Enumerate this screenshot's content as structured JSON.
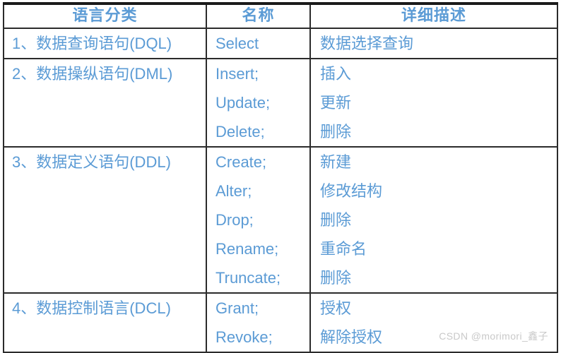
{
  "table": {
    "headers": [
      {
        "label": "语言分类"
      },
      {
        "label": "名称"
      },
      {
        "label": "详细描述"
      }
    ],
    "rows": [
      {
        "category": "1、数据查询语句(DQL)",
        "names": [
          "Select"
        ],
        "descriptions": [
          "数据选择查询"
        ]
      },
      {
        "category": "2、数据操纵语句(DML)",
        "names": [
          "Insert;",
          "Update;",
          "Delete;"
        ],
        "descriptions": [
          "插入",
          "更新",
          "删除"
        ]
      },
      {
        "category": "3、数据定义语句(DDL)",
        "names": [
          "Create;",
          "Alter;",
          "Drop;",
          "Rename;",
          "Truncate;"
        ],
        "descriptions": [
          "新建",
          "修改结构",
          "删除",
          "重命名",
          "删除"
        ]
      },
      {
        "category": "4、数据控制语言(DCL)",
        "names": [
          "Grant;",
          "Revoke;"
        ],
        "descriptions": [
          "授权",
          "解除授权"
        ]
      }
    ]
  },
  "watermark": {
    "text": "CSDN @morimori_鑫子"
  },
  "colors": {
    "text_blue": "#5b9bd5",
    "border_dark": "#2b2b2b",
    "background": "#ffffff",
    "watermark_gray": "#c9c9c9"
  }
}
